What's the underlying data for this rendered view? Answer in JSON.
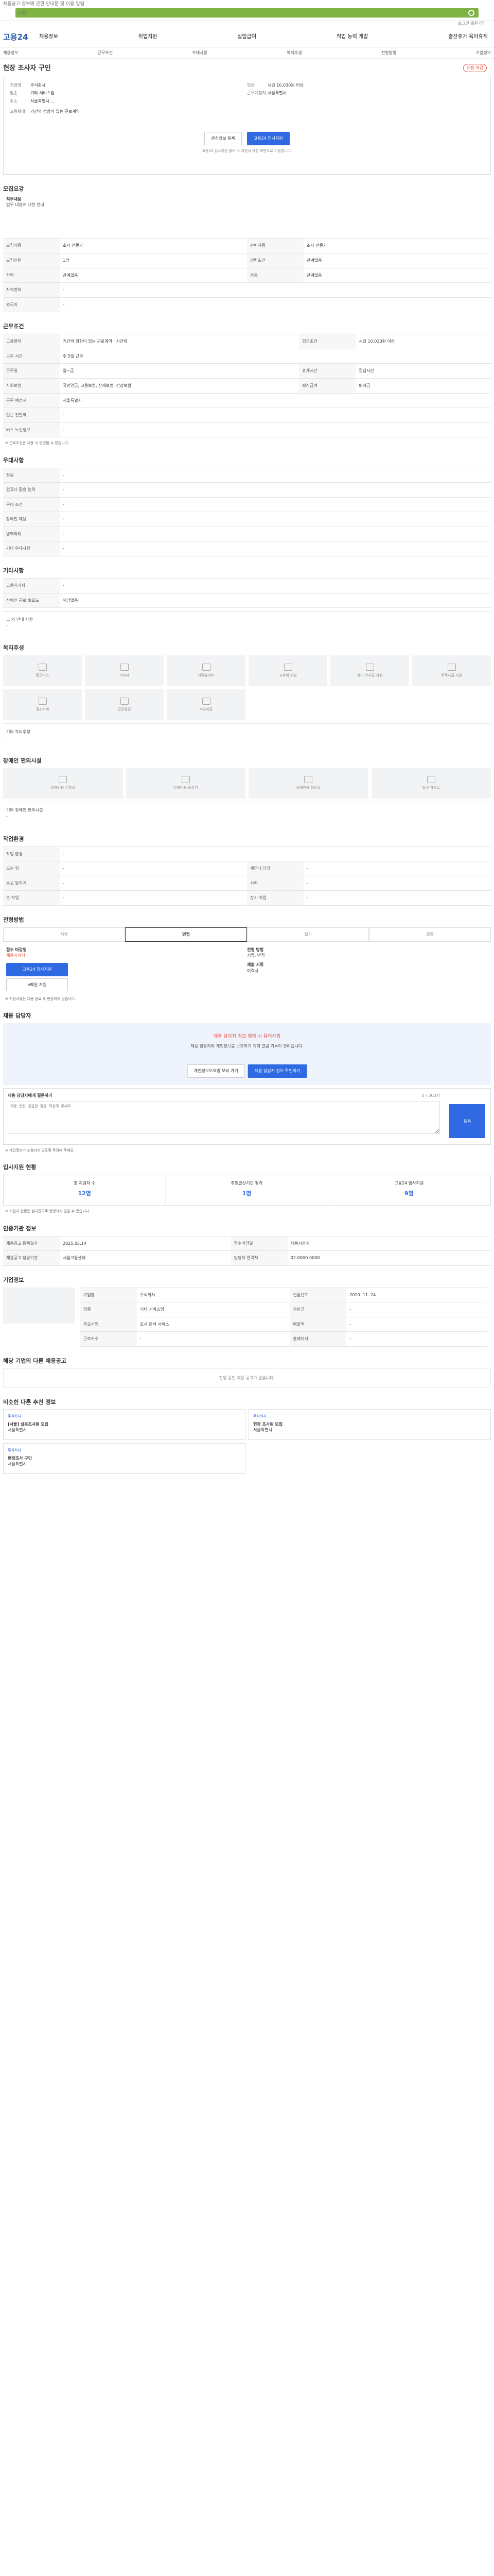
{
  "topbar": {
    "notice": "채용공고 정보에 관한 안내문 및 이용 알림",
    "search_placeholder": "지원",
    "util": "로그인 회원가입"
  },
  "nav": {
    "logo": "고용24",
    "menu": [
      "채용정보",
      "취업지원",
      "실업급여",
      "직업 능력 개발",
      "출산휴가·육아휴직"
    ]
  },
  "subnav": [
    "채용정보",
    "근무조건",
    "우대사항",
    "복지후생",
    "전형방법",
    "기업정보"
  ],
  "title": "현장 조사자 구인",
  "status_badge": "채용 마감",
  "company": {
    "name_label": "기업명",
    "name": "주식회사",
    "rep_label": "대표자",
    "rep": "",
    "ind_label": "업종",
    "ind": "기타 서비스업",
    "size_label": "규모",
    "size": "",
    "addr_label": "주소",
    "addr": "서울특별시 ...",
    "emp_label": "고용형태",
    "emp": "기간의 정함이 있는 근로계약",
    "work_label": "근무예정지",
    "wage_label": "임금",
    "wage": "시급 10,030원 이상"
  },
  "buttons": {
    "save": "관심정보 등록",
    "apply": "고용24 입사지원"
  },
  "apply_hint": "고용24 입사지원 클릭 시 지원서 작성 화면으로 이동합니다.",
  "sections": {
    "recruit": {
      "title": "모집요강",
      "duty_title": "직무내용",
      "duty": "업무 내용에 대한 안내",
      "rows": [
        [
          "모집직종",
          "조사 전문가",
          "관련직종",
          "조사 전문가"
        ],
        [
          "모집인원",
          "1명",
          "경력조건",
          "관계없음"
        ],
        [
          "학력",
          "관계없음",
          "전공",
          "관계없음"
        ],
        [
          "자격면허",
          "-",
          "",
          ""
        ],
        [
          "외국어",
          "-",
          "",
          ""
        ]
      ]
    },
    "work": {
      "title": "근무조건",
      "rows": [
        [
          "고용형태",
          "기간의 정함이 있는 근로계약 · 시간제",
          "임금조건",
          "시급 10,030원 이상"
        ],
        [
          "근무 시간",
          "주 5일 근무",
          "",
          ""
        ],
        [
          "근무일",
          "월~금",
          "휴게시간",
          "점심시간"
        ],
        [
          "사회보험",
          "국민연금, 고용보험, 산재보험, 건강보험",
          "퇴직급여",
          "퇴직금"
        ],
        [
          "근무 예정지",
          "서울특별시",
          "",
          ""
        ],
        [
          "인근 전철역",
          "-",
          "",
          ""
        ],
        [
          "버스 노선정보",
          "-",
          "",
          ""
        ]
      ],
      "note": "※ 근로조건은 채용 시 변경될 수 있습니다."
    },
    "pref": {
      "title": "우대사항",
      "rows": [
        [
          "전공",
          "-"
        ],
        [
          "컴퓨터 활용 능력",
          "-"
        ],
        [
          "우대 조건",
          "-"
        ],
        [
          "장애인 채용",
          "-"
        ],
        [
          "병역특례",
          "-"
        ],
        [
          "기타 우대사항",
          "-"
        ]
      ]
    },
    "etc": {
      "title": "기타사항",
      "rows": [
        [
          "고용허가제",
          "-"
        ],
        [
          "장애인 근로 필요도",
          "해당없음"
        ]
      ],
      "note_label": "그 외 안내 사항",
      "note": "-"
    },
    "welfare": {
      "title": "복리후생",
      "items": [
        "통근버스",
        "기숙사",
        "차량유지비",
        "교육비 지원",
        "자녀 학자금 지원",
        "주택자금 지원",
        "경조사비",
        "건강검진",
        "식사제공"
      ],
      "etc_label": "기타 복리후생",
      "etc": "-"
    },
    "disab": {
      "title": "장애인 편의시설",
      "items": [
        "장애인용 주차장",
        "장애인용 승강기",
        "장애인용 화장실",
        "입구 경사로"
      ],
      "etc_label": "기타 장애인 편의시설",
      "etc": "-"
    },
    "env": {
      "title": "작업환경",
      "rows": [
        [
          "작업 환경",
          "-",
          "",
          ""
        ],
        [
          "드는 힘",
          "-",
          "세부내 담당",
          "-"
        ],
        [
          "듣고 말하기",
          "-",
          "시력",
          "-"
        ],
        [
          "손 작업",
          "-",
          "장시 작업",
          "-"
        ]
      ]
    },
    "process": {
      "title": "전형방법",
      "steps": [
        "서류",
        "면접",
        "필기",
        "최종"
      ],
      "doc_label": "접수 마감일",
      "doc": "채용시까지",
      "method_label": "전형 방법",
      "method": "서류, 면접",
      "submit_label": "제출 서류",
      "submit": "이력서",
      "btn1": "고용24 입사지원",
      "btn2": "e메일 지원",
      "note": "※ 지원서류는 채용 완료 후 반환되지 않습니다."
    },
    "manager": {
      "title": "채용 담당자",
      "warn": "채용 담당자 정보 열람 시 유의사항",
      "desc": "채용 담당자의 개인정보를 보호하기 위해 열람 기록이 관리됩니다.",
      "btn1": "개인정보보호법 보러 가기",
      "btn2": "채용 담당자 정보 확인하기"
    },
    "qa": {
      "title": "채용 담당자에게 질문하기",
      "count": "0 / 300자",
      "placeholder": "채용 관련 궁금한 점을 작성해 주세요.",
      "submit": "등록",
      "note": "※ 개인정보가 포함되지 않도록 주의해 주세요."
    },
    "stats": {
      "title": "입사지원 현황",
      "items": [
        [
          "총 지원자 수",
          "12명"
        ],
        [
          "취업알선기관 평가",
          "1명"
        ],
        [
          "고용24 입사지원",
          "9명"
        ]
      ],
      "note": "※ 지원자 현황은 실시간으로 반영되지 않을 수 있습니다."
    },
    "info": {
      "title": "인증기관 정보",
      "rows": [
        [
          "채용공고 등록일자",
          "2025.05.14",
          "접수마감일",
          "채용시까지"
        ],
        [
          "채용공고 담당기관",
          "서울고용센터",
          "담당자 연락처",
          "02-0000-0000"
        ]
      ]
    },
    "cominfo": {
      "title": "기업정보",
      "rows": [
        [
          "기업명",
          "주식회사",
          "설립년도",
          "2020. 11. 24"
        ],
        [
          "업종",
          "기타 서비스업",
          "자본금",
          "-"
        ],
        [
          "주요사업",
          "조사 분석 서비스",
          "매출액",
          "-"
        ],
        [
          "근로자수",
          "-",
          "홈페이지",
          "-"
        ]
      ]
    },
    "same": {
      "title": "해당 기업의 다른 채용공고",
      "empty": "진행 중인 채용 공고가 없습니다."
    },
    "rec": {
      "title": "비슷한 다른 추천 정보",
      "items": [
        [
          "주식회사",
          "[서울] 설문조사원 모집",
          "서울특별시"
        ],
        [
          "주식회사",
          "현장 조사원 모집",
          "서울특별시"
        ],
        [
          "주식회사",
          "현장조사 구인",
          "서울특별시"
        ]
      ]
    }
  }
}
